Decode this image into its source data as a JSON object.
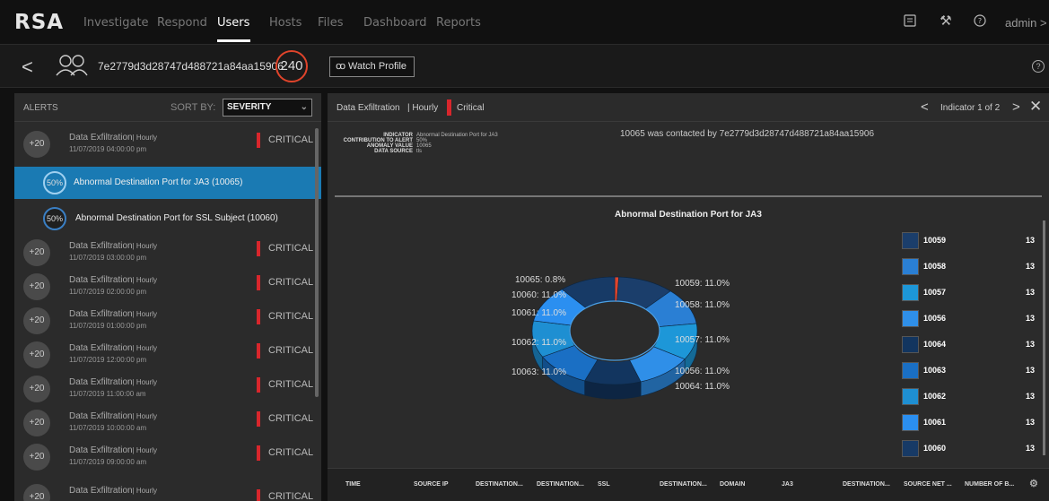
{
  "header": {
    "logo": "RSA",
    "nav": [
      "Investigate",
      "Respond",
      "Users",
      "Hosts",
      "Files",
      "Dashboard",
      "Reports"
    ],
    "active": "Users",
    "user": "admin"
  },
  "profile": {
    "user_id": "7e2779d3d28747d488721a84aa15906",
    "score": "240",
    "watch_label": "Watch Profile"
  },
  "alerts": {
    "title": "ALERTS",
    "sort_by": "SORT BY:",
    "sort_value": "SEVERITY",
    "items": [
      {
        "badge": "+20",
        "title": "Data Exfiltration",
        "sub": "| Hourly",
        "time": "11/07/2019 04:00:00 pm",
        "sev": "CRITICAL"
      },
      {
        "badge": "+20",
        "title": "Data Exfiltration",
        "sub": "| Hourly",
        "time": "11/07/2019 03:00:00 pm",
        "sev": "CRITICAL"
      },
      {
        "badge": "+20",
        "title": "Data Exfiltration",
        "sub": "| Hourly",
        "time": "11/07/2019 02:00:00 pm",
        "sev": "CRITICAL"
      },
      {
        "badge": "+20",
        "title": "Data Exfiltration",
        "sub": "| Hourly",
        "time": "11/07/2019 01:00:00 pm",
        "sev": "CRITICAL"
      },
      {
        "badge": "+20",
        "title": "Data Exfiltration",
        "sub": "| Hourly",
        "time": "11/07/2019 12:00:00 pm",
        "sev": "CRITICAL"
      },
      {
        "badge": "+20",
        "title": "Data Exfiltration",
        "sub": "| Hourly",
        "time": "11/07/2019 11:00:00 am",
        "sev": "CRITICAL"
      },
      {
        "badge": "+20",
        "title": "Data Exfiltration",
        "sub": "| Hourly",
        "time": "11/07/2019 10:00:00 am",
        "sev": "CRITICAL"
      },
      {
        "badge": "+20",
        "title": "Data Exfiltration",
        "sub": "| Hourly",
        "time": "11/07/2019 09:00:00 am",
        "sev": "CRITICAL"
      },
      {
        "badge": "+20",
        "title": "Data Exfiltration",
        "sub": "| Hourly",
        "time": "",
        "sev": "CRITICAL"
      }
    ],
    "indicators": [
      {
        "pct": "50%",
        "label": "Abnormal Destination Port for JA3 (10065)"
      },
      {
        "pct": "50%",
        "label": "Abnormal Destination Port for SSL Subject (10060)"
      }
    ]
  },
  "detail": {
    "alert": "Data Exfiltration",
    "freq": "| Hourly",
    "sev": "Critical",
    "pager": "Indicator 1 of 2",
    "meta": {
      "k1": "INDICATOR",
      "v1": "Abnormal Destination Port for JA3",
      "k2": "CONTRIBUTION TO ALERT",
      "v2": "50%",
      "k3": "ANOMALY VALUE",
      "v3": "10065",
      "k4": "DATA SOURCE",
      "v4": "tls"
    },
    "description": "10065 was contacted by 7e2779d3d28747d488721a84aa15906"
  },
  "colors": {
    "critical": "#d8262c",
    "selected": "#1a7ab3",
    "score_ring": "#e0442b"
  },
  "chart_data": {
    "type": "pie",
    "title": "Abnormal Destination Port for JA3",
    "slices": [
      {
        "label": "10065",
        "value": 0.8,
        "display": "10065: 0.8%",
        "color": "#e0442b"
      },
      {
        "label": "10059",
        "value": 11.0,
        "display": "10059: 11.0%",
        "color": "#1b3e6b"
      },
      {
        "label": "10058",
        "value": 11.0,
        "display": "10058: 11.0%",
        "color": "#2a7fd4"
      },
      {
        "label": "10057",
        "value": 11.0,
        "display": "10057: 11.0%",
        "color": "#1d97d8"
      },
      {
        "label": "10056",
        "value": 11.0,
        "display": "10056: 11.0%",
        "color": "#2f8fe8"
      },
      {
        "label": "10064",
        "value": 11.0,
        "display": "10064: 11.0%",
        "color": "#12355f"
      },
      {
        "label": "10063",
        "value": 11.0,
        "display": "10063: 11.0%",
        "color": "#1a6fc4"
      },
      {
        "label": "10062",
        "value": 11.0,
        "display": "10062: 11.0%",
        "color": "#1e8fd2"
      },
      {
        "label": "10061",
        "value": 11.0,
        "display": "10061: 11.0%",
        "color": "#2b8ff0"
      },
      {
        "label": "10060",
        "value": 11.0,
        "display": "10060: 11.0%",
        "color": "#173a66"
      }
    ],
    "legend": [
      {
        "name": "10059",
        "count": "13",
        "color": "#1b3e6b"
      },
      {
        "name": "10058",
        "count": "13",
        "color": "#2a7fd4"
      },
      {
        "name": "10057",
        "count": "13",
        "color": "#1d97d8"
      },
      {
        "name": "10056",
        "count": "13",
        "color": "#2f8fe8"
      },
      {
        "name": "10064",
        "count": "13",
        "color": "#12355f"
      },
      {
        "name": "10063",
        "count": "13",
        "color": "#1a6fc4"
      },
      {
        "name": "10062",
        "count": "13",
        "color": "#1e8fd2"
      },
      {
        "name": "10061",
        "count": "13",
        "color": "#2b8ff0"
      },
      {
        "name": "10060",
        "count": "13",
        "color": "#173a66"
      }
    ]
  },
  "table": {
    "columns": [
      "TIME",
      "SOURCE IP",
      "DESTINATION...",
      "DESTINATION...",
      "SSL",
      "DESTINATION...",
      "DOMAIN",
      "JA3",
      "DESTINATION...",
      "SOURCE NET ...",
      "NUMBER OF B..."
    ]
  }
}
